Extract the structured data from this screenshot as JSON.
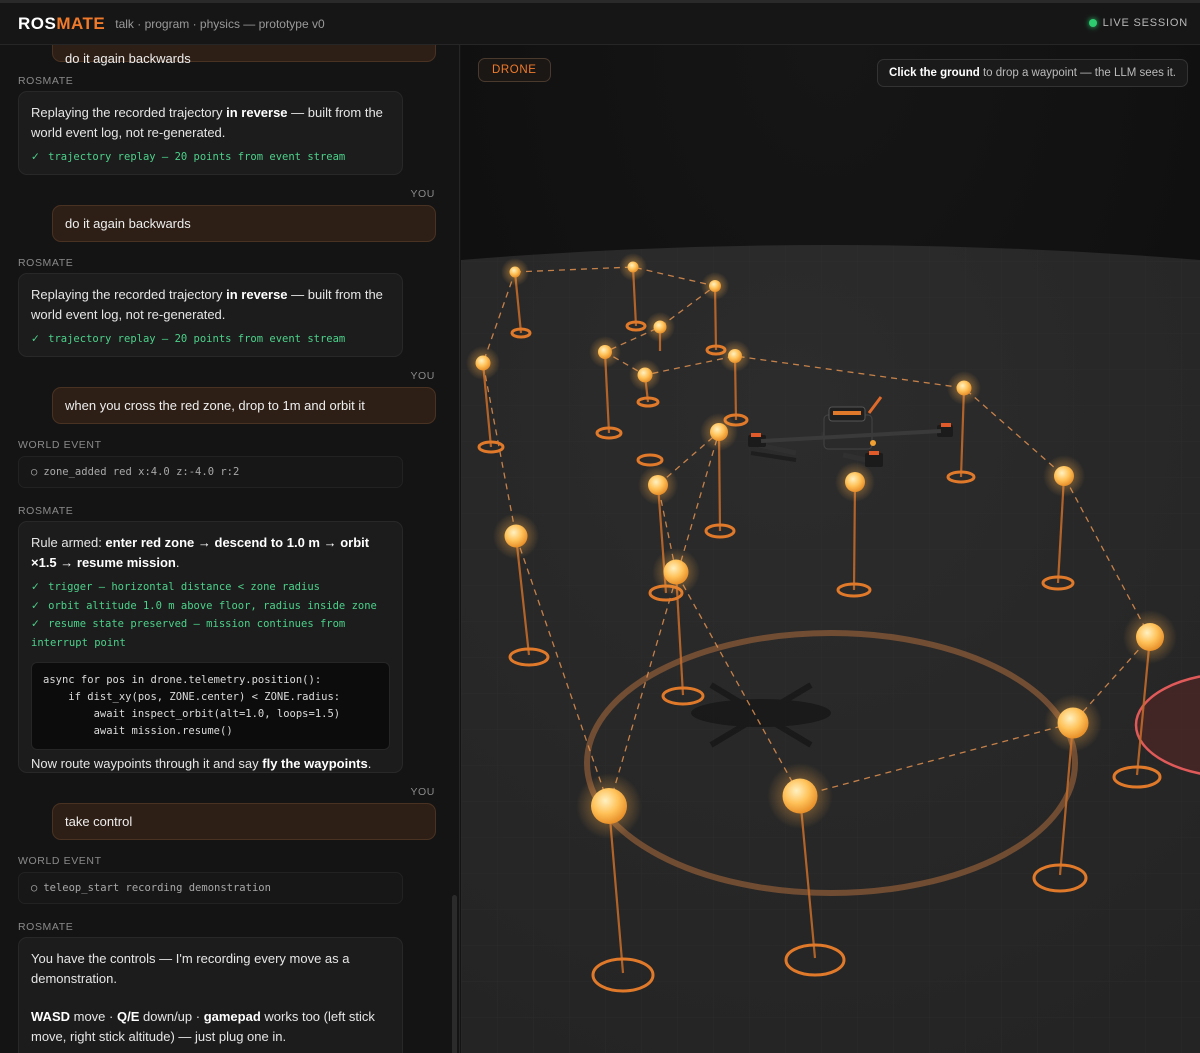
{
  "topbar": {
    "brand_a": "ROS",
    "brand_b": "MATE",
    "subtitle": "talk · program · physics — prototype v0",
    "live": "LIVE SESSION"
  },
  "chat": {
    "clipped_msg": "do it again backwards",
    "m1_label": "ROSMATE",
    "m1_pre": "Replaying the recorded trajectory ",
    "m1_bold": "in reverse",
    "m1_post": " — built from the world event log, not re-generated.",
    "m1_check": "trajectory replay — 20 points from event stream",
    "m2_label": "YOU",
    "m2_text": "do it again backwards",
    "m3_label": "ROSMATE",
    "m3_pre": "Replaying the recorded trajectory ",
    "m3_bold": "in reverse",
    "m3_post": " — built from the world event log, not re-generated.",
    "m3_check": "trajectory replay — 20 points from event stream",
    "m4_label": "YOU",
    "m4_text": "when you cross the red zone, drop to 1m and orbit it",
    "m5_label": "WORLD EVENT",
    "m5_text": "zone_added red x:4.0 z:-4.0 r:2",
    "m6_label": "ROSMATE",
    "m6_pre": "Rule armed: ",
    "m6_bold": "enter red zone → descend to 1.0 m → orbit ×1.5 → resume mission",
    "m6_post": ".",
    "m6_check1": "trigger — horizontal distance < zone radius",
    "m6_check2": "orbit altitude 1.0 m above floor, radius inside zone",
    "m6_check3": "resume state preserved — mission continues from interrupt point",
    "m6_code": "async for pos in drone.telemetry.position():\n    if dist_xy(pos, ZONE.center) < ZONE.radius:\n        await inspect_orbit(alt=1.0, loops=1.5)\n        await mission.resume()",
    "m6_after_pre": "Now route waypoints through it and say ",
    "m6_after_bold": "fly the waypoints",
    "m6_after_post": ".",
    "m7_label": "YOU",
    "m7_text": "take control",
    "m8_label": "WORLD EVENT",
    "m8_text": "teleop_start recording demonstration",
    "m9_label": "ROSMATE",
    "m9_p1": "You have the controls — I'm recording every move as a demonstration.",
    "m9_k1": "WASD",
    "m9_t1": " move · ",
    "m9_k2": "Q/E",
    "m9_t2": " down/up · ",
    "m9_k3": "gamepad",
    "m9_t3": " works too (left stick move, right stick altitude) — just plug one in."
  },
  "scene": {
    "drone_tag": "DRONE",
    "hint_bold": "Click the ground",
    "hint_rest": " to drop a waypoint — the LLM sees it."
  },
  "colors": {
    "accent": "#f07a2a",
    "live": "#2ecc71",
    "check": "#4cd18a",
    "zone": "#e05a5a"
  },
  "icons": {
    "event_icon": "hollow-circle-icon",
    "check_icon": "checkmark-icon",
    "live_icon": "status-dot-icon"
  }
}
